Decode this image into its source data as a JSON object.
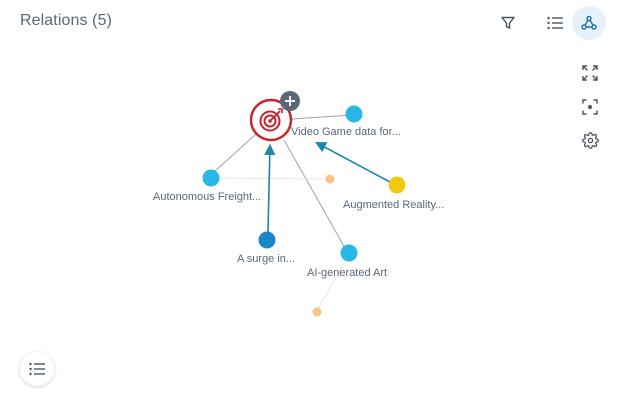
{
  "header": {
    "title": "Relations (5)"
  },
  "toolbar": {
    "filter_icon": "filter-icon",
    "list_icon": "list-icon",
    "graph_icon": "network-graph-icon",
    "active": "graph"
  },
  "side_tools": [
    {
      "icon": "expand-icon"
    },
    {
      "icon": "focus-icon"
    },
    {
      "icon": "gear-icon"
    }
  ],
  "graph": {
    "center_icon": "target-icon",
    "add_icon": "plus-icon",
    "nodes": [
      {
        "id": "video-game",
        "label": "Video Game data for...",
        "color": "#29b6e8"
      },
      {
        "id": "autonomous",
        "label": "Autonomous Freight...",
        "color": "#29b6e8"
      },
      {
        "id": "augmented",
        "label": "Augmented Reality...",
        "color": "#f2c811"
      },
      {
        "id": "surge",
        "label": "A surge in...",
        "color": "#1a86c8"
      },
      {
        "id": "ai-art",
        "label": "AI-generated Art",
        "color": "#29b6e8"
      }
    ],
    "small_nodes_color": "#f9c48c",
    "edge_color": "#9aa3ab",
    "arrow_color": "#1d86a9",
    "center_color": "#c9242c"
  },
  "bottom": {
    "list_icon": "list-icon"
  }
}
